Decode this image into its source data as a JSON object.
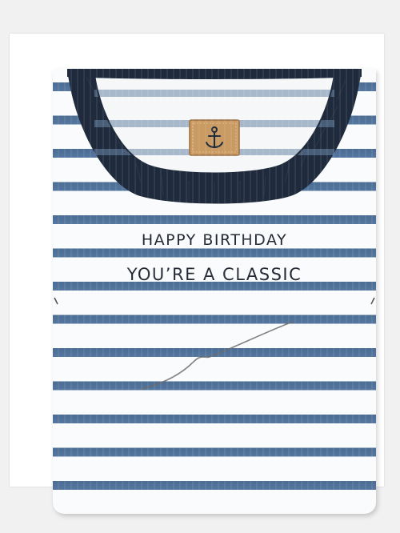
{
  "card": {
    "message_line1": "HAPPY BIRTHDAY",
    "message_line2": "YOU’RE A CLASSIC",
    "label_icon": "anchor-icon"
  },
  "colors": {
    "background": "#f1f1f1",
    "stripe_navy": "#4b6d94",
    "collar_navy": "#1f2b3c",
    "label_tan": "#c99a62",
    "text": "#222833"
  }
}
